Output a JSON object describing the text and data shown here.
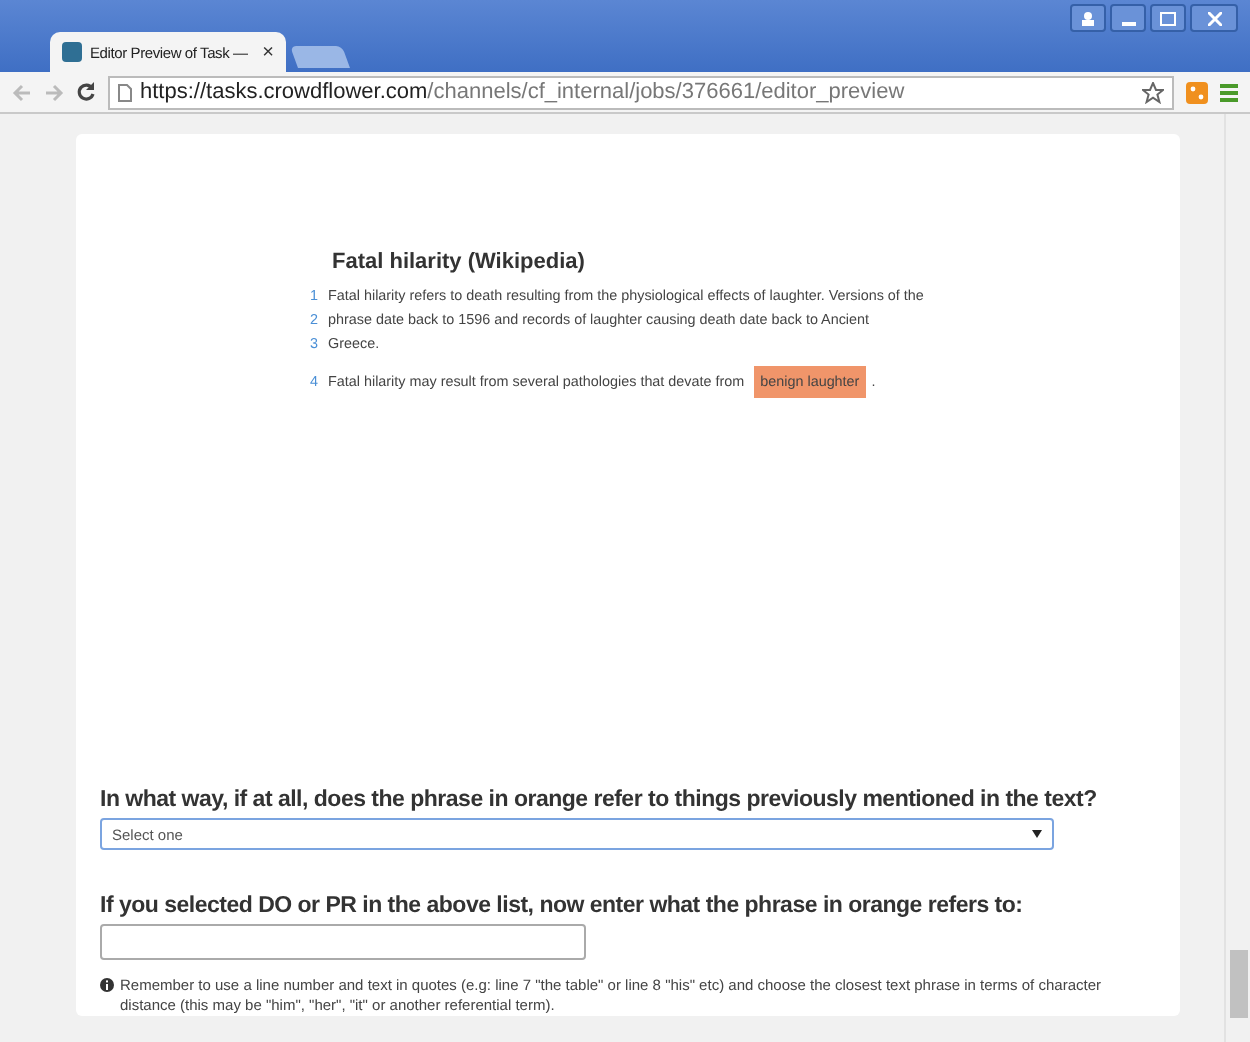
{
  "browser": {
    "tab_title": "Editor Preview of Task —",
    "tab_close": "×",
    "url_host": "https://tasks.crowdflower.com",
    "url_path": "/channels/cf_internal/jobs/376661/editor_preview"
  },
  "article": {
    "title": "Fatal hilarity (Wikipedia)",
    "paragraphs": [
      {
        "lines": [
          {
            "number": "1",
            "text": "Fatal hilarity refers to death resulting from the physiological effects of laughter. Versions of the"
          },
          {
            "number": "2",
            "text": "phrase date back to 1596 and records of laughter causing death date back to Ancient"
          },
          {
            "number": "3",
            "text": "Greece."
          }
        ]
      },
      {
        "lines": [
          {
            "number": "4",
            "text": "Fatal hilarity may result from several pathologies that devate from",
            "highlight": "benign laughter",
            "after": "."
          }
        ]
      }
    ]
  },
  "questions": [
    {
      "kind": "select",
      "label": "In what way, if at all, does the phrase in orange refer to things previously mentioned in the text?",
      "value": "Select one"
    },
    {
      "kind": "text",
      "label": "If you selected DO or PR in the above list, now enter what the phrase in orange refers to:",
      "note": "Remember to use a line number and text in quotes (e.g: line 7 \"the table\" or line 8 \"his\" etc) and choose the closest text phrase in terms of character distance (this may be \"him\", \"her\", \"it\" or another referential term)."
    }
  ]
}
